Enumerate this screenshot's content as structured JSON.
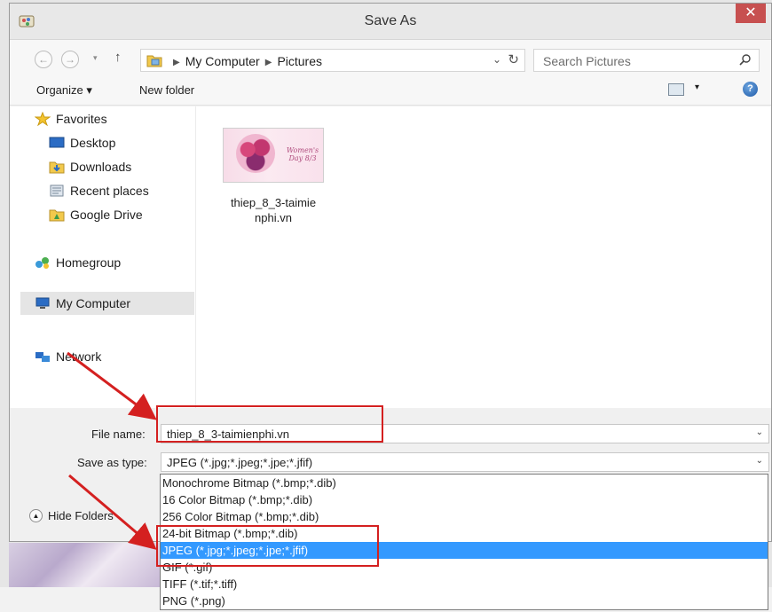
{
  "window": {
    "title": "Save As",
    "close_glyph": "✕"
  },
  "navigation": {
    "back_glyph": "←",
    "forward_glyph": "→",
    "up_glyph": "↑",
    "breadcrumb": [
      "My Computer",
      "Pictures"
    ],
    "search_placeholder": "Search Pictures",
    "refresh_icon": "refresh-icon",
    "search_icon": "search-icon"
  },
  "toolbar": {
    "organize_label": "Organize ▾",
    "new_folder_label": "New folder",
    "view_drop": "▾",
    "help_glyph": "?"
  },
  "sidebar": {
    "favorites_label": "Favorites",
    "favorites": [
      "Desktop",
      "Downloads",
      "Recent places",
      "Google Drive"
    ],
    "homegroup_label": "Homegroup",
    "my_computer_label": "My Computer",
    "network_label": "Network"
  },
  "files": [
    {
      "name": "thiep_8_3-taimie\nnphi.vn",
      "thumb_text": "Women's Day 8/3"
    }
  ],
  "form": {
    "file_name_label": "File name:",
    "file_name_value": "thiep_8_3-taimienphi.vn",
    "save_type_label": "Save as type:",
    "save_type_value": "JPEG (*.jpg;*.jpeg;*.jpe;*.jfif)",
    "hide_folders_label": "Hide Folders"
  },
  "file_types": [
    "Monochrome Bitmap (*.bmp;*.dib)",
    "16 Color Bitmap (*.bmp;*.dib)",
    "256 Color Bitmap (*.bmp;*.dib)",
    "24-bit Bitmap (*.bmp;*.dib)",
    "JPEG (*.jpg;*.jpeg;*.jpe;*.jfif)",
    "GIF (*.gif)",
    "TIFF (*.tif;*.tiff)",
    "PNG (*.png)"
  ],
  "selected_file_type": "JPEG (*.jpg;*.jpeg;*.jpe;*.jfif)",
  "colors": {
    "highlight": "#3399ff",
    "annotation_red": "#d42020",
    "close_red": "#c75050"
  }
}
